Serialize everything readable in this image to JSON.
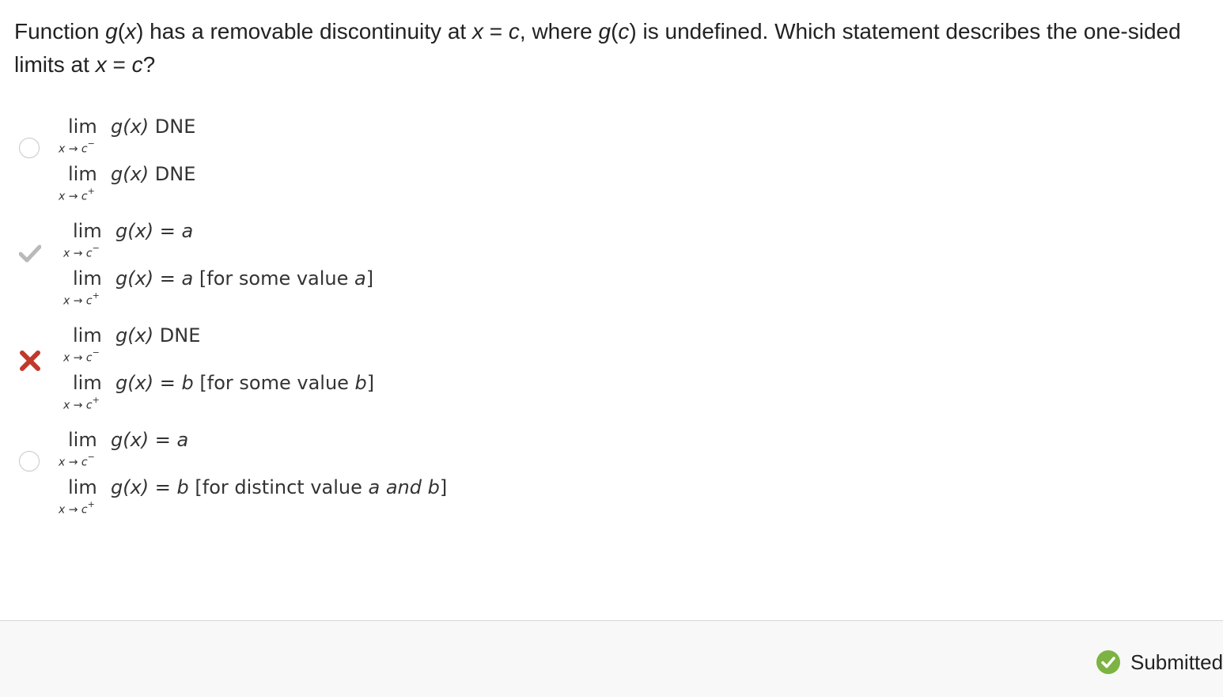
{
  "question": {
    "p1": "Function ",
    "g": "g",
    "p2": "(",
    "x1": "x",
    "p3": ") has a removable discontinuity at ",
    "x2": "x",
    "p4": " = ",
    "c1": "c",
    "p5": ", where ",
    "g2": "g",
    "p6": "(",
    "c2": "c",
    "p7": ") is undefined. Which statement describes the one-sided limits at ",
    "x3": "x",
    "p8": " = ",
    "c3": "c",
    "p9": "?"
  },
  "lim_word": "lim",
  "sub_left": "x → c",
  "sup_left": "−",
  "sub_right": "x → c",
  "sup_right": "+",
  "choices": [
    {
      "state": "unselected",
      "line1": {
        "gx": "g(x)",
        "rest": " DNE"
      },
      "line2": {
        "gx": "g(x)",
        "rest": " DNE"
      }
    },
    {
      "state": "correct-answer",
      "line1": {
        "gx": "g(x)",
        "rest": "  = ",
        "var": "a"
      },
      "line2": {
        "gx": "g(x)",
        "rest": " = ",
        "var": "a",
        "note_open": "   [for some value ",
        "note_var": "a",
        "note_close": "]"
      }
    },
    {
      "state": "selected-incorrect",
      "line1": {
        "gx": "g(x)",
        "rest": " DNE"
      },
      "line2": {
        "gx": "g(x)",
        "rest": " = ",
        "var": "b",
        "note_open": "   [for some value ",
        "note_var": "b",
        "note_close": "]"
      }
    },
    {
      "state": "unselected",
      "line1": {
        "gx": "g(x)",
        "rest": "  = ",
        "var": "a"
      },
      "line2": {
        "gx": "g(x)",
        "rest": " = ",
        "var": "b",
        "note_open": "   [for distinct value ",
        "note_var": "a and b",
        "note_close": "]"
      }
    }
  ],
  "footer": {
    "status_label": "Submitted",
    "status_icon": "check-circle-icon"
  },
  "colors": {
    "check_gray": "#b9b9b9",
    "cross_red": "#c0392b",
    "status_green": "#7cb342"
  }
}
